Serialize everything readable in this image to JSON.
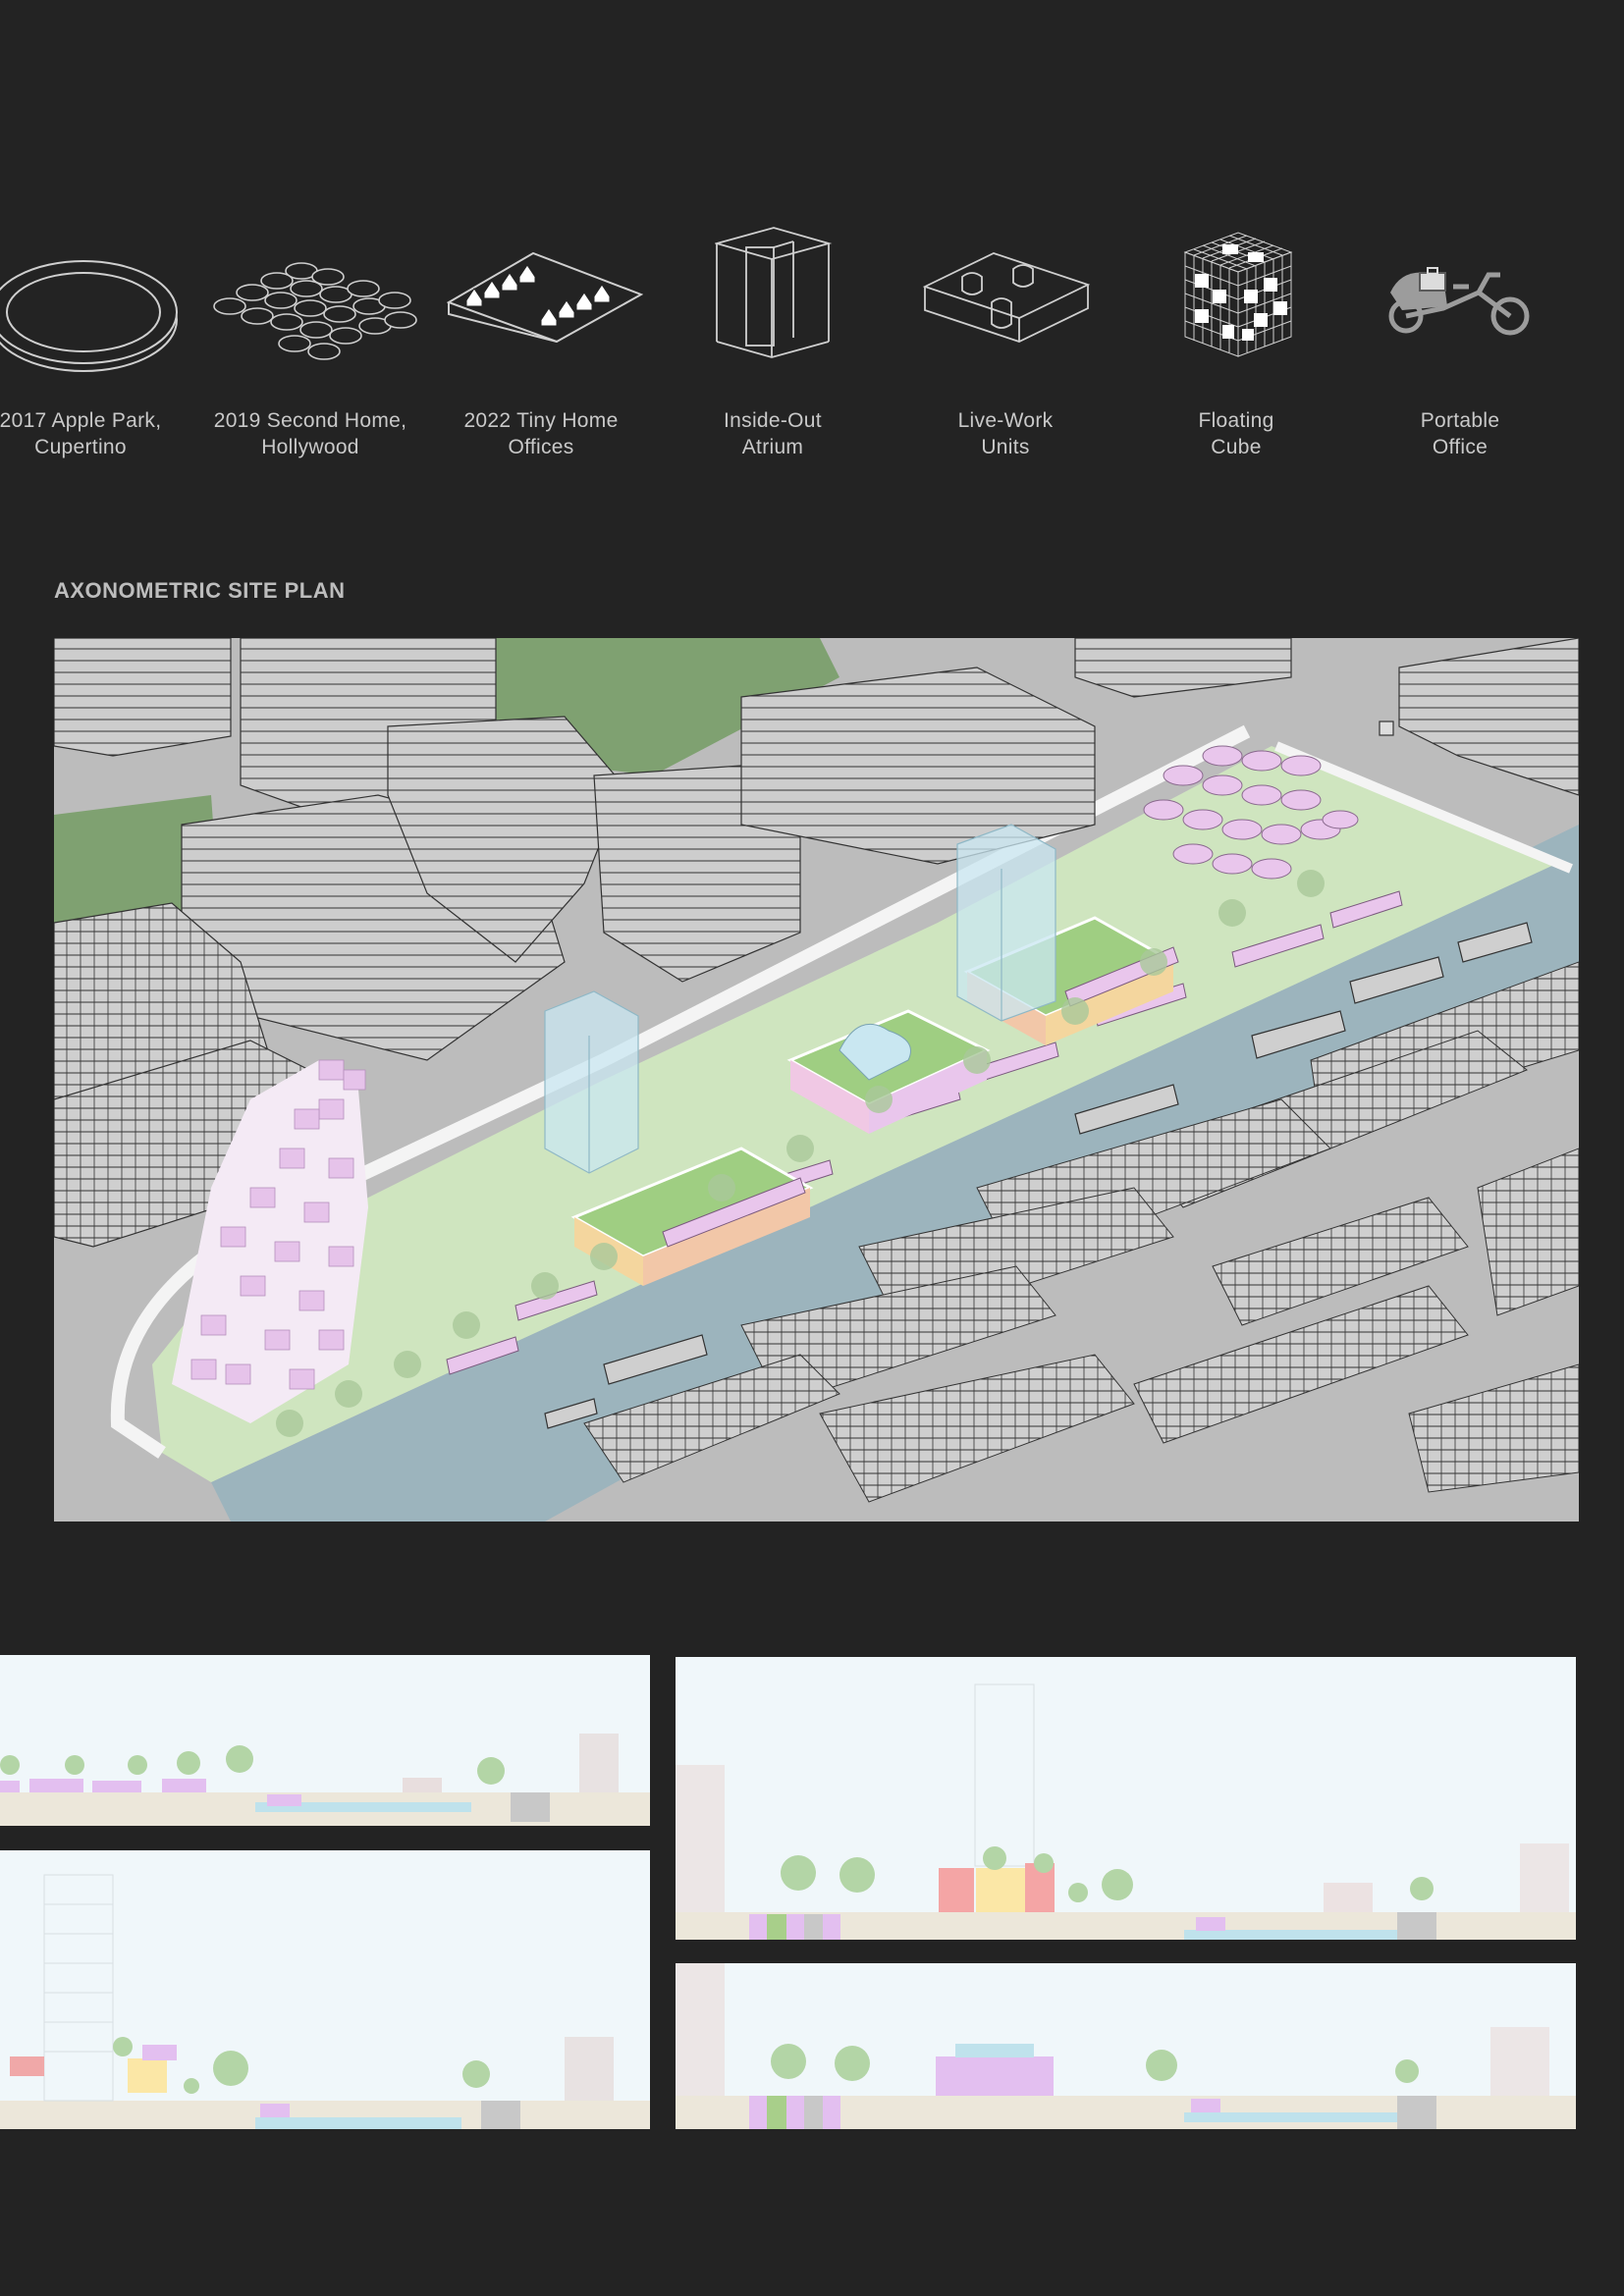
{
  "typologies": [
    {
      "icon": "ring-building-icon",
      "line1": "2017 Apple Park,",
      "line2": "Cupertino"
    },
    {
      "icon": "cylinder-cluster-icon",
      "line1": "2019 Second Home,",
      "line2": "Hollywood"
    },
    {
      "icon": "tiny-houses-icon",
      "line1": "2022 Tiny Home",
      "line2": "Offices"
    },
    {
      "icon": "atrium-tower-icon",
      "line1": "Inside-Out",
      "line2": "Atrium"
    },
    {
      "icon": "interlocking-blocks-icon",
      "line1": "Live-Work",
      "line2": "Units"
    },
    {
      "icon": "cube-grid-icon",
      "line1": "Floating",
      "line2": "Cube"
    },
    {
      "icon": "cargo-bike-icon",
      "line1": "Portable",
      "line2": "Office"
    }
  ],
  "site_plan": {
    "title": "AXONOMETRIC SITE PLAN"
  },
  "colors": {
    "background": "#232323",
    "label_text": "#c9c9c9",
    "ground": "#bdbdbd",
    "park": "#cfe5bf",
    "water": "#9cb4bd",
    "module_pink": "#e9c6ec",
    "glass_blue": "#c9e7f1",
    "section_sky": "#f0f7fa"
  }
}
